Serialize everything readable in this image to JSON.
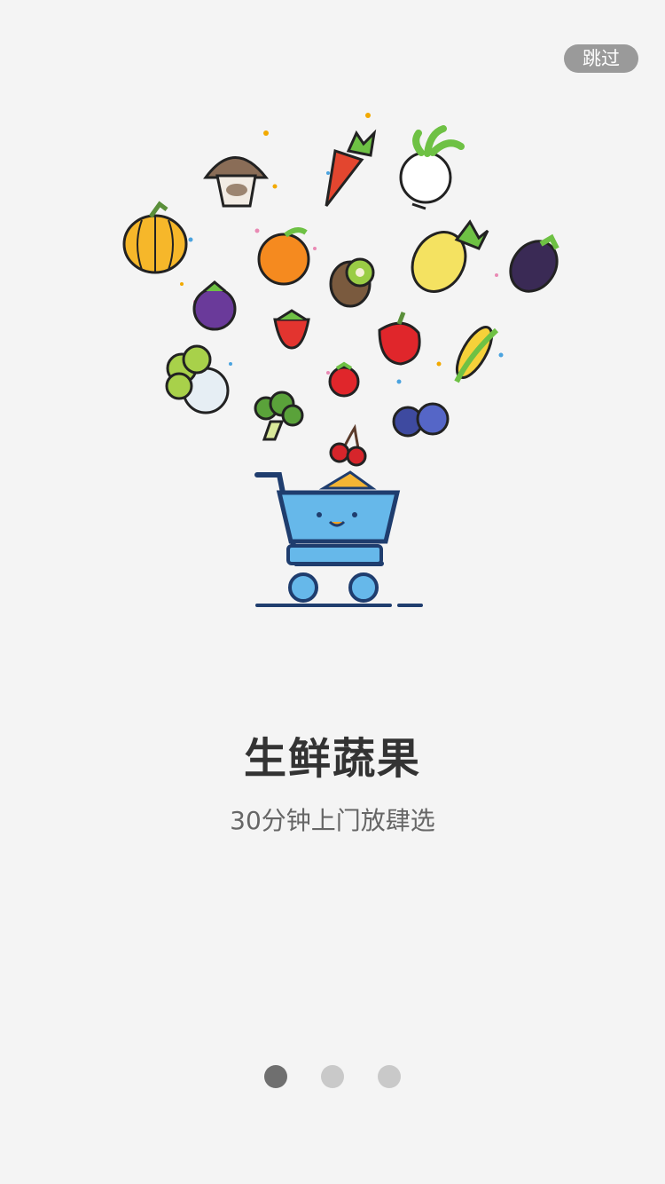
{
  "skip": {
    "label": "跳过"
  },
  "onboarding": {
    "title": "生鲜蔬果",
    "subtitle": "30分钟上门放肆选",
    "page_indicator": {
      "total": 3,
      "current": 1
    }
  },
  "illustration": {
    "items": [
      "mushroom-icon",
      "carrot-icon",
      "radish-icon",
      "pumpkin-icon",
      "orange-icon",
      "kiwi-icon",
      "pineapple-icon",
      "eggplant-icon",
      "mangosteen-icon",
      "strawberry-icon",
      "apple-icon",
      "corn-icon",
      "cabbage-icon",
      "tomato-icon",
      "broccoli-icon",
      "blueberry-icon",
      "cherry-icon",
      "shopping-cart-icon"
    ]
  }
}
